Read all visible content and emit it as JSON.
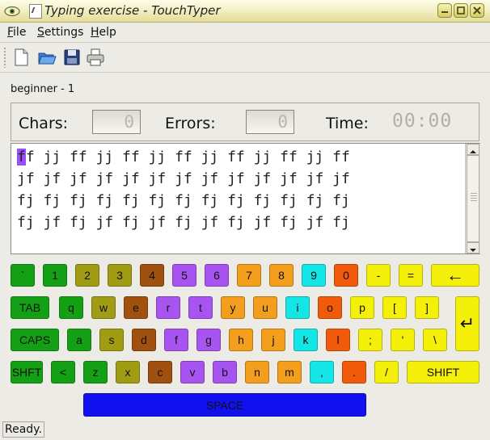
{
  "window": {
    "title": "Typing exercise - TouchTyper"
  },
  "menu": [
    {
      "underline": "F",
      "rest": "ile"
    },
    {
      "underline": "S",
      "rest": "ettings"
    },
    {
      "underline": "H",
      "rest": "elp"
    }
  ],
  "toolbar": [
    "new-icon",
    "open-icon",
    "save-icon",
    "print-icon"
  ],
  "level": "beginner - 1",
  "stats": {
    "chars_label": "Chars:",
    "chars_value": "0",
    "errors_label": "Errors:",
    "errors_value": "0",
    "time_label": "Time:",
    "time_value": "00:00"
  },
  "exercise": {
    "cursor_char": "f",
    "first_line_rest": "f jj ff jj ff jj ff jj ff jj ff jj ff",
    "lines": [
      "jf jf jf jf jf jf jf jf jf jf jf jf jf",
      "fj fj fj fj fj fj fj fj fj fj fj fj fj",
      "fj jf fj jf fj jf fj jf fj jf fj jf fj"
    ]
  },
  "keyboard": {
    "rows": [
      [
        {
          "label": "`",
          "color": "#14a014"
        },
        {
          "label": "1",
          "color": "#14a014"
        },
        {
          "label": "2",
          "color": "#a09c14"
        },
        {
          "label": "3",
          "color": "#a09c14"
        },
        {
          "label": "4",
          "color": "#a0500f"
        },
        {
          "label": "5",
          "color": "#a854f0"
        },
        {
          "label": "6",
          "color": "#a854f0"
        },
        {
          "label": "7",
          "color": "#f39e1c"
        },
        {
          "label": "8",
          "color": "#f39e1c"
        },
        {
          "label": "9",
          "color": "#14e6e8"
        },
        {
          "label": "0",
          "color": "#f05a0a"
        },
        {
          "label": "-",
          "color": "#f5f00a"
        },
        {
          "label": "=",
          "color": "#f5f00a"
        },
        {
          "label": "←",
          "color": "#f5f00a"
        }
      ],
      [
        {
          "label": "TAB",
          "color": "#14a014"
        },
        {
          "label": "q",
          "color": "#14a014"
        },
        {
          "label": "w",
          "color": "#a09c14"
        },
        {
          "label": "e",
          "color": "#a0500f"
        },
        {
          "label": "r",
          "color": "#a854f0"
        },
        {
          "label": "t",
          "color": "#a854f0"
        },
        {
          "label": "y",
          "color": "#f39e1c"
        },
        {
          "label": "u",
          "color": "#f39e1c"
        },
        {
          "label": "i",
          "color": "#14e6e8"
        },
        {
          "label": "o",
          "color": "#f05a0a"
        },
        {
          "label": "p",
          "color": "#f5f00a"
        },
        {
          "label": "[",
          "color": "#f5f00a"
        },
        {
          "label": "]",
          "color": "#f5f00a"
        }
      ],
      [
        {
          "label": "CAPS",
          "color": "#14a014"
        },
        {
          "label": "a",
          "color": "#14a014"
        },
        {
          "label": "s",
          "color": "#a09c14"
        },
        {
          "label": "d",
          "color": "#a0500f"
        },
        {
          "label": "f",
          "color": "#a854f0"
        },
        {
          "label": "g",
          "color": "#a854f0"
        },
        {
          "label": "h",
          "color": "#f39e1c"
        },
        {
          "label": "j",
          "color": "#f39e1c"
        },
        {
          "label": "k",
          "color": "#14e6e8"
        },
        {
          "label": "l",
          "color": "#f05a0a"
        },
        {
          "label": ";",
          "color": "#f5f00a"
        },
        {
          "label": "'",
          "color": "#f5f00a"
        },
        {
          "label": "\\",
          "color": "#f5f00a"
        }
      ],
      [
        {
          "label": "SHFT",
          "color": "#14a014"
        },
        {
          "label": "<",
          "color": "#14a014"
        },
        {
          "label": "z",
          "color": "#14a014"
        },
        {
          "label": "x",
          "color": "#a09c14"
        },
        {
          "label": "c",
          "color": "#a0500f"
        },
        {
          "label": "v",
          "color": "#a854f0"
        },
        {
          "label": "b",
          "color": "#a854f0"
        },
        {
          "label": "n",
          "color": "#f39e1c"
        },
        {
          "label": "m",
          "color": "#f39e1c"
        },
        {
          "label": ",",
          "color": "#14e6e8"
        },
        {
          "label": ".",
          "color": "#f05a0a"
        },
        {
          "label": "/",
          "color": "#f5f00a"
        },
        {
          "label": "SHIFT",
          "color": "#f5f00a"
        }
      ]
    ],
    "enter": {
      "label": "↵",
      "color": "#f5f00a"
    },
    "space": {
      "label": "SPACE",
      "color": "#1010f0"
    }
  },
  "status": "Ready."
}
